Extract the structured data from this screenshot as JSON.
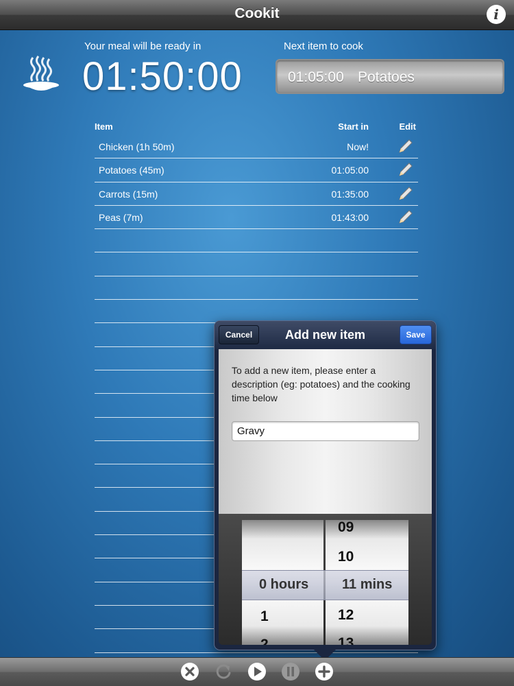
{
  "app": {
    "title": "Cookit",
    "info_label": "i"
  },
  "header": {
    "ready_label": "Your meal will be ready in",
    "ready_time": "01:50:00",
    "next_label": "Next item to cook",
    "next_time": "01:05:00",
    "next_item": "Potatoes"
  },
  "table": {
    "columns": {
      "item": "Item",
      "start": "Start in",
      "edit": "Edit"
    },
    "rows": [
      {
        "name": "Chicken (1h 50m)",
        "start": "Now!"
      },
      {
        "name": "Potatoes (45m)",
        "start": "01:05:00"
      },
      {
        "name": "Carrots (15m)",
        "start": "01:35:00"
      },
      {
        "name": "Peas (7m)",
        "start": "01:43:00"
      }
    ]
  },
  "popover": {
    "title": "Add new item",
    "cancel_label": "Cancel",
    "save_label": "Save",
    "instructions": "To add a new item, please enter a description (eg: potatoes) and the cooking time below",
    "input_value": "Gravy",
    "picker": {
      "hours_items": [
        "",
        "1",
        "2"
      ],
      "selected_hours": "0 hours",
      "mins_items": [
        "09",
        "10",
        "12",
        "13"
      ],
      "selected_mins": "11 mins"
    }
  },
  "toolbar": {
    "buttons": [
      "close-icon",
      "refresh-icon",
      "play-icon",
      "pause-icon",
      "add-icon"
    ]
  },
  "colors": {
    "background": "#2f7ab8",
    "save_blue": "#2f74e6",
    "nav_dark": "#1b2640"
  }
}
